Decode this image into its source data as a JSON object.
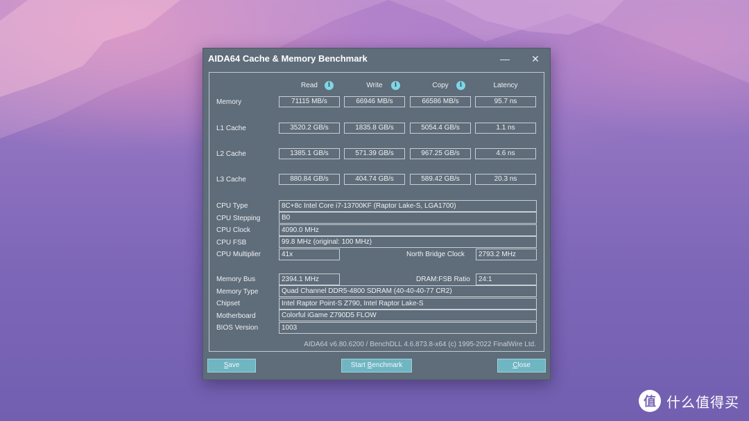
{
  "window": {
    "title": "AIDA64 Cache & Memory Benchmark",
    "minimize_icon": "minimize-icon",
    "close_icon": "close-icon"
  },
  "columns": {
    "read": "Read",
    "write": "Write",
    "copy": "Copy",
    "latency": "Latency",
    "info_glyph": "i"
  },
  "bench": [
    {
      "label": "Memory",
      "read": "71115 MB/s",
      "write": "66946 MB/s",
      "copy": "66586 MB/s",
      "latency": "95.7 ns"
    },
    {
      "label": "L1 Cache",
      "read": "3520.2 GB/s",
      "write": "1835.8 GB/s",
      "copy": "5054.4 GB/s",
      "latency": "1.1 ns"
    },
    {
      "label": "L2 Cache",
      "read": "1385.1 GB/s",
      "write": "571.39 GB/s",
      "copy": "967.25 GB/s",
      "latency": "4.6 ns"
    },
    {
      "label": "L3 Cache",
      "read": "880.84 GB/s",
      "write": "404.74 GB/s",
      "copy": "589.42 GB/s",
      "latency": "20.3 ns"
    }
  ],
  "sysinfo": {
    "cpu_type_label": "CPU Type",
    "cpu_type": "8C+8c Intel Core i7-13700KF  (Raptor Lake-S, LGA1700)",
    "cpu_stepping_label": "CPU Stepping",
    "cpu_stepping": "B0",
    "cpu_clock_label": "CPU Clock",
    "cpu_clock": "4090.0 MHz",
    "cpu_fsb_label": "CPU FSB",
    "cpu_fsb": "99.8 MHz  (original: 100 MHz)",
    "cpu_multiplier_label": "CPU Multiplier",
    "cpu_multiplier": "41x",
    "nb_clock_label": "North Bridge Clock",
    "nb_clock": "2793.2 MHz",
    "memory_bus_label": "Memory Bus",
    "memory_bus": "2394.1 MHz",
    "dram_fsb_label": "DRAM:FSB Ratio",
    "dram_fsb": "24:1",
    "memory_type_label": "Memory Type",
    "memory_type": "Quad Channel DDR5-4800 SDRAM  (40-40-40-77 CR2)",
    "chipset_label": "Chipset",
    "chipset": "Intel Raptor Point-S Z790, Intel Raptor Lake-S",
    "motherboard_label": "Motherboard",
    "motherboard": "Colorful iGame Z790D5 FLOW",
    "bios_label": "BIOS Version",
    "bios": "1003"
  },
  "footer": "AIDA64 v6.80.6200 / BenchDLL 4.6.873.8-x64  (c) 1995-2022 FinalWire Ltd.",
  "buttons": {
    "save_first": "S",
    "save_rest": "ave",
    "start_pre": "Start ",
    "start_first": "B",
    "start_rest": "enchmark",
    "close_first": "C",
    "close_rest": "lose"
  },
  "watermark": {
    "logo_glyph": "值",
    "text": "什么值得买"
  },
  "colors": {
    "window_bg": "#5f6c79",
    "button_bg": "#6fb5c2",
    "info_icon": "#7fd6e6"
  }
}
